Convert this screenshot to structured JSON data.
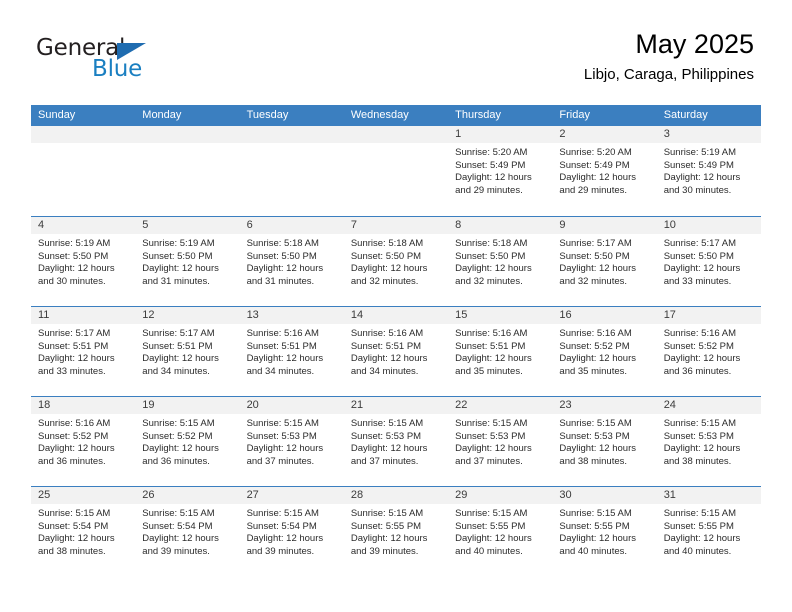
{
  "brand": {
    "name_part1": "General",
    "name_part2": "Blue",
    "accent_color": "#1f6cb0",
    "text_color": "#231f20"
  },
  "header": {
    "title": "May 2025",
    "subtitle": "Libjo, Caraga, Philippines"
  },
  "theme": {
    "header_bar": "#3b7fc0",
    "day_band": "#f2f2f2",
    "text": "#2b2b2b"
  },
  "weekdays": [
    "Sunday",
    "Monday",
    "Tuesday",
    "Wednesday",
    "Thursday",
    "Friday",
    "Saturday"
  ],
  "weeks": [
    [
      {
        "date": "",
        "sunrise": "",
        "sunset": "",
        "daylight_line1": "",
        "daylight_line2": ""
      },
      {
        "date": "",
        "sunrise": "",
        "sunset": "",
        "daylight_line1": "",
        "daylight_line2": ""
      },
      {
        "date": "",
        "sunrise": "",
        "sunset": "",
        "daylight_line1": "",
        "daylight_line2": ""
      },
      {
        "date": "",
        "sunrise": "",
        "sunset": "",
        "daylight_line1": "",
        "daylight_line2": ""
      },
      {
        "date": "1",
        "sunrise": "Sunrise: 5:20 AM",
        "sunset": "Sunset: 5:49 PM",
        "daylight_line1": "Daylight: 12 hours",
        "daylight_line2": "and 29 minutes."
      },
      {
        "date": "2",
        "sunrise": "Sunrise: 5:20 AM",
        "sunset": "Sunset: 5:49 PM",
        "daylight_line1": "Daylight: 12 hours",
        "daylight_line2": "and 29 minutes."
      },
      {
        "date": "3",
        "sunrise": "Sunrise: 5:19 AM",
        "sunset": "Sunset: 5:49 PM",
        "daylight_line1": "Daylight: 12 hours",
        "daylight_line2": "and 30 minutes."
      }
    ],
    [
      {
        "date": "4",
        "sunrise": "Sunrise: 5:19 AM",
        "sunset": "Sunset: 5:50 PM",
        "daylight_line1": "Daylight: 12 hours",
        "daylight_line2": "and 30 minutes."
      },
      {
        "date": "5",
        "sunrise": "Sunrise: 5:19 AM",
        "sunset": "Sunset: 5:50 PM",
        "daylight_line1": "Daylight: 12 hours",
        "daylight_line2": "and 31 minutes."
      },
      {
        "date": "6",
        "sunrise": "Sunrise: 5:18 AM",
        "sunset": "Sunset: 5:50 PM",
        "daylight_line1": "Daylight: 12 hours",
        "daylight_line2": "and 31 minutes."
      },
      {
        "date": "7",
        "sunrise": "Sunrise: 5:18 AM",
        "sunset": "Sunset: 5:50 PM",
        "daylight_line1": "Daylight: 12 hours",
        "daylight_line2": "and 32 minutes."
      },
      {
        "date": "8",
        "sunrise": "Sunrise: 5:18 AM",
        "sunset": "Sunset: 5:50 PM",
        "daylight_line1": "Daylight: 12 hours",
        "daylight_line2": "and 32 minutes."
      },
      {
        "date": "9",
        "sunrise": "Sunrise: 5:17 AM",
        "sunset": "Sunset: 5:50 PM",
        "daylight_line1": "Daylight: 12 hours",
        "daylight_line2": "and 32 minutes."
      },
      {
        "date": "10",
        "sunrise": "Sunrise: 5:17 AM",
        "sunset": "Sunset: 5:50 PM",
        "daylight_line1": "Daylight: 12 hours",
        "daylight_line2": "and 33 minutes."
      }
    ],
    [
      {
        "date": "11",
        "sunrise": "Sunrise: 5:17 AM",
        "sunset": "Sunset: 5:51 PM",
        "daylight_line1": "Daylight: 12 hours",
        "daylight_line2": "and 33 minutes."
      },
      {
        "date": "12",
        "sunrise": "Sunrise: 5:17 AM",
        "sunset": "Sunset: 5:51 PM",
        "daylight_line1": "Daylight: 12 hours",
        "daylight_line2": "and 34 minutes."
      },
      {
        "date": "13",
        "sunrise": "Sunrise: 5:16 AM",
        "sunset": "Sunset: 5:51 PM",
        "daylight_line1": "Daylight: 12 hours",
        "daylight_line2": "and 34 minutes."
      },
      {
        "date": "14",
        "sunrise": "Sunrise: 5:16 AM",
        "sunset": "Sunset: 5:51 PM",
        "daylight_line1": "Daylight: 12 hours",
        "daylight_line2": "and 34 minutes."
      },
      {
        "date": "15",
        "sunrise": "Sunrise: 5:16 AM",
        "sunset": "Sunset: 5:51 PM",
        "daylight_line1": "Daylight: 12 hours",
        "daylight_line2": "and 35 minutes."
      },
      {
        "date": "16",
        "sunrise": "Sunrise: 5:16 AM",
        "sunset": "Sunset: 5:52 PM",
        "daylight_line1": "Daylight: 12 hours",
        "daylight_line2": "and 35 minutes."
      },
      {
        "date": "17",
        "sunrise": "Sunrise: 5:16 AM",
        "sunset": "Sunset: 5:52 PM",
        "daylight_line1": "Daylight: 12 hours",
        "daylight_line2": "and 36 minutes."
      }
    ],
    [
      {
        "date": "18",
        "sunrise": "Sunrise: 5:16 AM",
        "sunset": "Sunset: 5:52 PM",
        "daylight_line1": "Daylight: 12 hours",
        "daylight_line2": "and 36 minutes."
      },
      {
        "date": "19",
        "sunrise": "Sunrise: 5:15 AM",
        "sunset": "Sunset: 5:52 PM",
        "daylight_line1": "Daylight: 12 hours",
        "daylight_line2": "and 36 minutes."
      },
      {
        "date": "20",
        "sunrise": "Sunrise: 5:15 AM",
        "sunset": "Sunset: 5:53 PM",
        "daylight_line1": "Daylight: 12 hours",
        "daylight_line2": "and 37 minutes."
      },
      {
        "date": "21",
        "sunrise": "Sunrise: 5:15 AM",
        "sunset": "Sunset: 5:53 PM",
        "daylight_line1": "Daylight: 12 hours",
        "daylight_line2": "and 37 minutes."
      },
      {
        "date": "22",
        "sunrise": "Sunrise: 5:15 AM",
        "sunset": "Sunset: 5:53 PM",
        "daylight_line1": "Daylight: 12 hours",
        "daylight_line2": "and 37 minutes."
      },
      {
        "date": "23",
        "sunrise": "Sunrise: 5:15 AM",
        "sunset": "Sunset: 5:53 PM",
        "daylight_line1": "Daylight: 12 hours",
        "daylight_line2": "and 38 minutes."
      },
      {
        "date": "24",
        "sunrise": "Sunrise: 5:15 AM",
        "sunset": "Sunset: 5:53 PM",
        "daylight_line1": "Daylight: 12 hours",
        "daylight_line2": "and 38 minutes."
      }
    ],
    [
      {
        "date": "25",
        "sunrise": "Sunrise: 5:15 AM",
        "sunset": "Sunset: 5:54 PM",
        "daylight_line1": "Daylight: 12 hours",
        "daylight_line2": "and 38 minutes."
      },
      {
        "date": "26",
        "sunrise": "Sunrise: 5:15 AM",
        "sunset": "Sunset: 5:54 PM",
        "daylight_line1": "Daylight: 12 hours",
        "daylight_line2": "and 39 minutes."
      },
      {
        "date": "27",
        "sunrise": "Sunrise: 5:15 AM",
        "sunset": "Sunset: 5:54 PM",
        "daylight_line1": "Daylight: 12 hours",
        "daylight_line2": "and 39 minutes."
      },
      {
        "date": "28",
        "sunrise": "Sunrise: 5:15 AM",
        "sunset": "Sunset: 5:55 PM",
        "daylight_line1": "Daylight: 12 hours",
        "daylight_line2": "and 39 minutes."
      },
      {
        "date": "29",
        "sunrise": "Sunrise: 5:15 AM",
        "sunset": "Sunset: 5:55 PM",
        "daylight_line1": "Daylight: 12 hours",
        "daylight_line2": "and 40 minutes."
      },
      {
        "date": "30",
        "sunrise": "Sunrise: 5:15 AM",
        "sunset": "Sunset: 5:55 PM",
        "daylight_line1": "Daylight: 12 hours",
        "daylight_line2": "and 40 minutes."
      },
      {
        "date": "31",
        "sunrise": "Sunrise: 5:15 AM",
        "sunset": "Sunset: 5:55 PM",
        "daylight_line1": "Daylight: 12 hours",
        "daylight_line2": "and 40 minutes."
      }
    ]
  ]
}
